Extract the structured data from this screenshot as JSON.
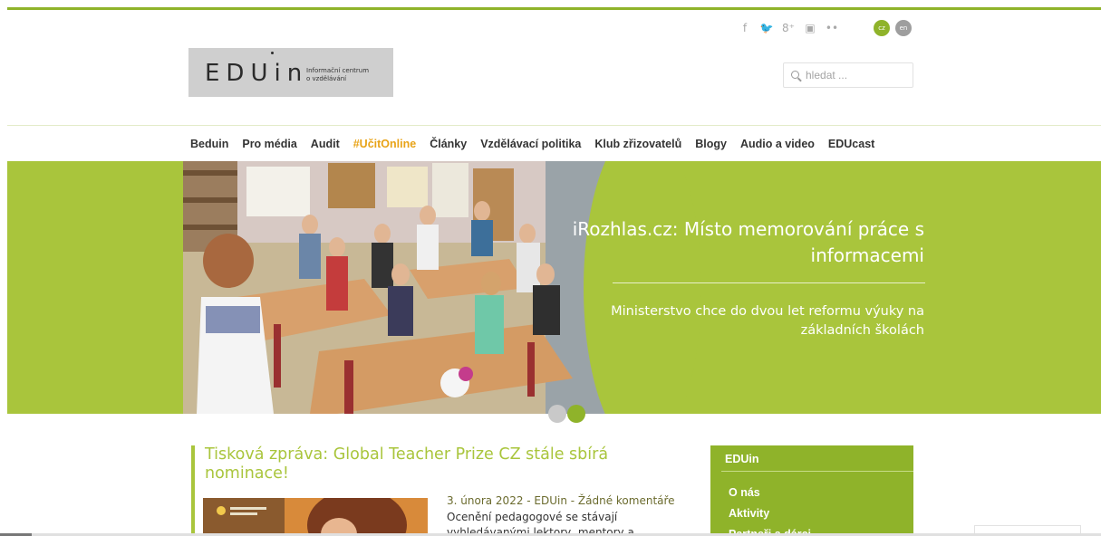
{
  "header": {
    "logo_text": "EDUin",
    "logo_subtitle_line1": "Informační centrum",
    "logo_subtitle_line2": "o vzdělávání",
    "social_icons": [
      "facebook-icon",
      "twitter-icon",
      "google-plus-icon",
      "youtube-icon",
      "flickr-icon"
    ],
    "social_glyphs": [
      "f",
      "🐦",
      "8⁺",
      "▣",
      "••"
    ],
    "languages": [
      "cz",
      "en"
    ],
    "search_placeholder": "hledat ..."
  },
  "nav": {
    "items": [
      "Beduin",
      "Pro média",
      "Audit",
      "#UčitOnline",
      "Články",
      "Vzdělávací politika",
      "Klub zřizovatelů",
      "Blogy",
      "Audio a video",
      "EDUcast"
    ],
    "highlighted": "#UčitOnline"
  },
  "slider": {
    "title": "iRozhlas.cz: Místo memorování práce s informacemi",
    "subtitle": "Ministerstvo chce do dvou let reformu výuky na základních školách",
    "slides": 2,
    "active_slide": 2
  },
  "article": {
    "title": "Tisková zpráva: Global Teacher Prize CZ stále sbírá nominace!",
    "meta": "3. února 2022 - EDUin - Žádné komentáře",
    "excerpt": "Ocenění pedagogové se stávají vyhledávanými lektory, mentory a"
  },
  "sidebar": {
    "heading": "EDUin",
    "items": [
      "O nás",
      "Aktivity",
      "Partneři a dárci"
    ]
  },
  "colors": {
    "accent": "#a9c53c",
    "accent_dark": "#8fb32a",
    "highlight": "#e8a317"
  }
}
